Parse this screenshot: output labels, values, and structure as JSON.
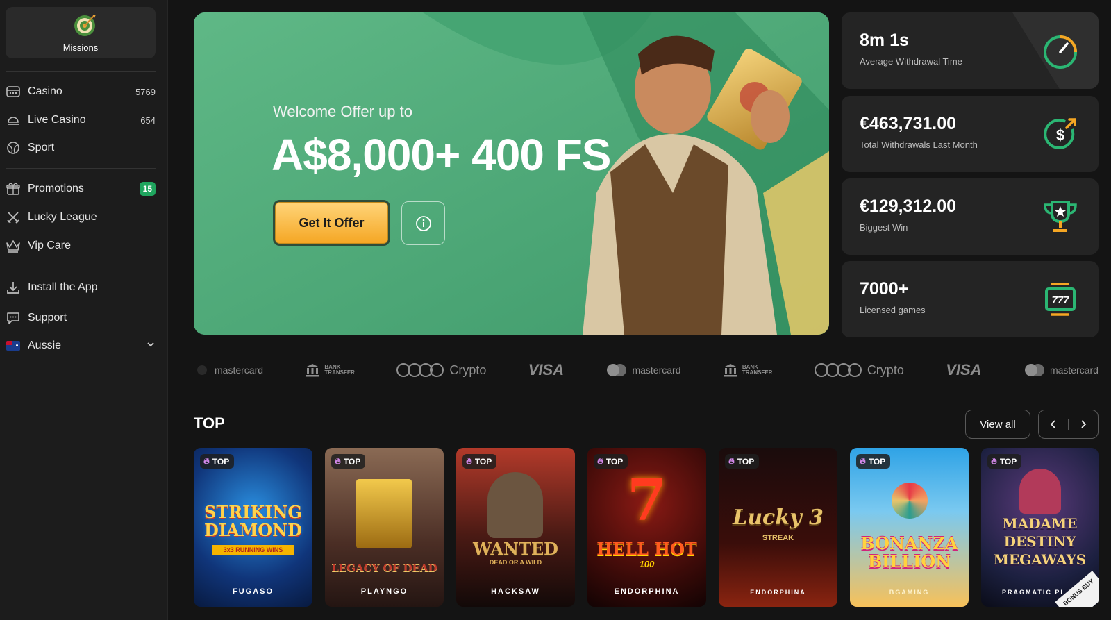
{
  "sidebar": {
    "missions_label": "Missions",
    "nav_primary": [
      {
        "label": "Casino",
        "count": "5769"
      },
      {
        "label": "Live Casino",
        "count": "654"
      },
      {
        "label": "Sport",
        "count": ""
      }
    ],
    "nav_secondary": [
      {
        "label": "Promotions",
        "badge": "15"
      },
      {
        "label": "Lucky League"
      },
      {
        "label": "Vip Care"
      }
    ],
    "nav_tertiary": [
      {
        "label": "Install the App"
      },
      {
        "label": "Support"
      },
      {
        "label": "Aussie"
      }
    ]
  },
  "hero": {
    "subtitle": "Welcome Offer up to",
    "amount": "A$8,000+ 400 FS",
    "cta_label": "Get It Offer"
  },
  "stats": [
    {
      "value": "8m 1s",
      "label": "Average Withdrawal Time",
      "icon": "speedometer-icon"
    },
    {
      "value": "€463,731.00",
      "label": "Total Withdrawals Last Month",
      "icon": "dollar-arrow-icon"
    },
    {
      "value": "€129,312.00",
      "label": "Biggest Win",
      "icon": "trophy-icon"
    },
    {
      "value": "7000+",
      "label": "Licensed games",
      "icon": "slot-machine-icon"
    }
  ],
  "payments": {
    "mastercard": "mastercard",
    "bank_line1": "BANK",
    "bank_line2": "TRANSFER",
    "crypto": "Crypto",
    "visa": "VISA"
  },
  "top_section": {
    "title": "TOP",
    "view_all": "View all",
    "tag_label": "TOP",
    "games": [
      {
        "title": "STRIKING DIAMOND",
        "extra": "3x3 RUNNING WINS",
        "provider": "FUGASO"
      },
      {
        "title": "LEGACY OF DEAD",
        "extra": "",
        "provider": "PLAYNGO"
      },
      {
        "title": "WANTED",
        "extra": "DEAD OR A WILD",
        "provider": "HACKSAW"
      },
      {
        "title": "HELL HOT",
        "extra": "100",
        "provider": "ENDORPHINA"
      },
      {
        "title": "Lucky 3",
        "extra": "STREAK",
        "provider": "ENDORPHINA"
      },
      {
        "title": "BONANZA BILLION",
        "extra": "",
        "provider": "BGAMING"
      },
      {
        "title": "MADAME DESTINY MEGAWAYS",
        "extra": "",
        "provider": "PRAGMATIC PL",
        "bonus": "BONUS BUY"
      }
    ]
  },
  "colors": {
    "hero_green": "#4fae7c",
    "accent_green": "#1fa55e",
    "cta_yellow": "#f5a623",
    "icon_green": "#2bb673"
  }
}
